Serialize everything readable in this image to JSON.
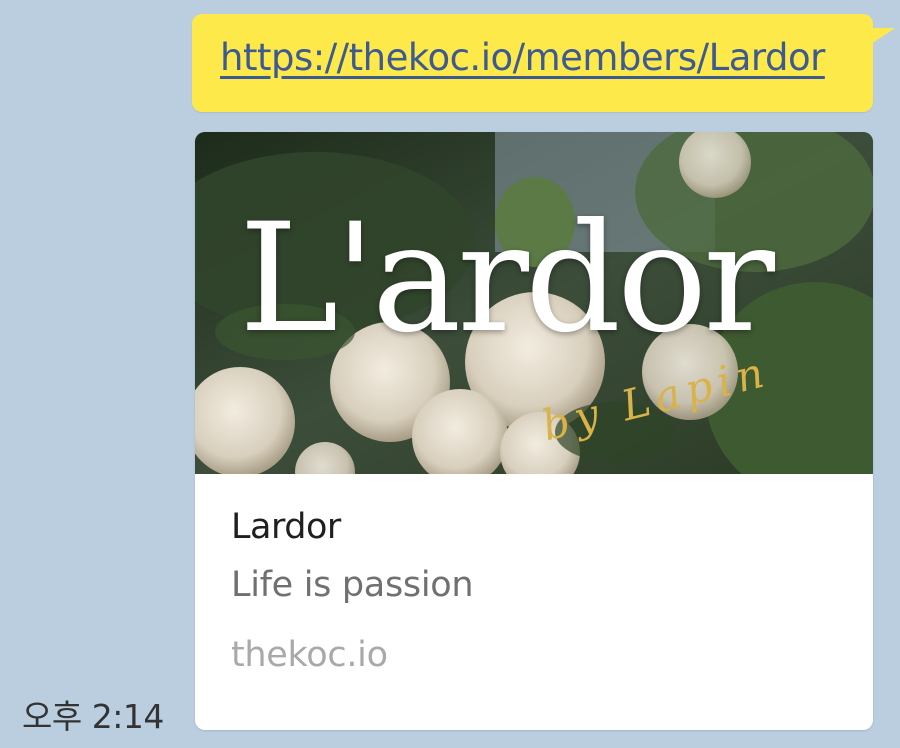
{
  "message": {
    "url": "https://thekoc.io/members/Lardor",
    "timestamp": "오후 2:14"
  },
  "preview": {
    "image_text": "L'ardor",
    "image_signature": "by Lapin",
    "title": "Lardor",
    "description": "Life is passion",
    "domain": "thekoc.io"
  },
  "colors": {
    "chat_background": "#bacee0",
    "bubble": "#fee94a",
    "link": "#3d5b92",
    "card": "#ffffff"
  }
}
